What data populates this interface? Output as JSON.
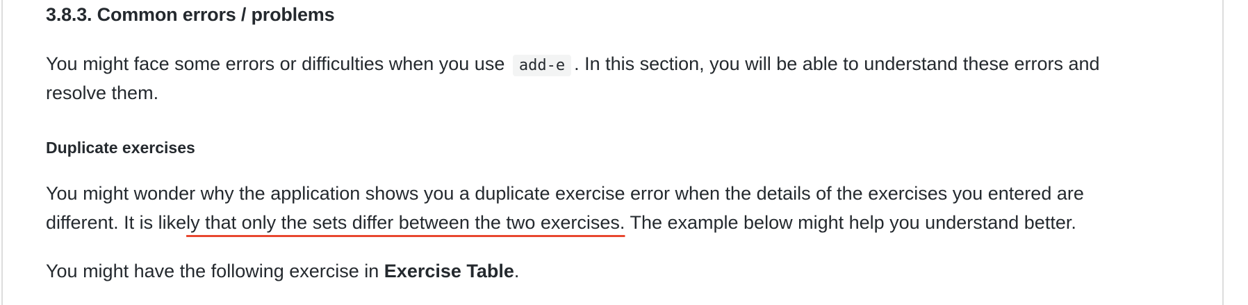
{
  "section": {
    "title": "3.8.3. Common errors / problems",
    "intro_before_code": "You might face some errors or difficulties when you use ",
    "code": "add-e",
    "intro_after_code": ". In this section, you will be able to understand these errors and",
    "intro_line2": "resolve them."
  },
  "subsection": {
    "title": "Duplicate exercises",
    "para1_line1": "You might wonder why the application shows you a duplicate exercise error when the details of the exercises you entered are",
    "para1_line2_start": "different. It is like",
    "para1_line2_highlight": "ly that only the sets differ between the two exercises.",
    "para1_line2_end": " The example below might help you understand better.",
    "para2_before": "You might have the following exercise in ",
    "para2_bold": "Exercise Table",
    "para2_after": ".",
    "highlight_color": "#e8472f"
  }
}
